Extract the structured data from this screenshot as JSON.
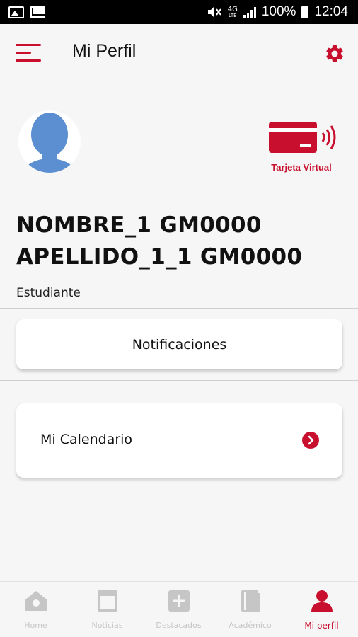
{
  "status_bar": {
    "network_top": "4G",
    "network_bottom": "LTE",
    "battery": "100%",
    "time": "12:04"
  },
  "header": {
    "title": "Mi Perfil",
    "menu_icon": "hamburger-menu-icon",
    "settings_icon": "gear-icon"
  },
  "profile": {
    "name_line1": "NOMBRE_1 GM0000",
    "name_line2": "APELLIDO_1_1 GM0000",
    "role": "Estudiante",
    "virtual_card_label": "Tarjeta Virtual"
  },
  "cards": {
    "notifications_label": "Notificaciones",
    "calendar_label": "Mi Calendario"
  },
  "bottom_nav": {
    "items": [
      {
        "label": "Home",
        "icon": "home-icon",
        "active": false
      },
      {
        "label": "Noticias",
        "icon": "news-icon",
        "active": false
      },
      {
        "label": "Destacados",
        "icon": "plus-square-icon",
        "active": false
      },
      {
        "label": "Académico",
        "icon": "book-icon",
        "active": false
      },
      {
        "label": "Mi perfil",
        "icon": "person-icon",
        "active": true
      }
    ]
  },
  "colors": {
    "accent": "#c8102e",
    "avatar": "#5b8fd1",
    "inactive_nav": "#c6c6c6",
    "background": "#f6f6f6"
  }
}
